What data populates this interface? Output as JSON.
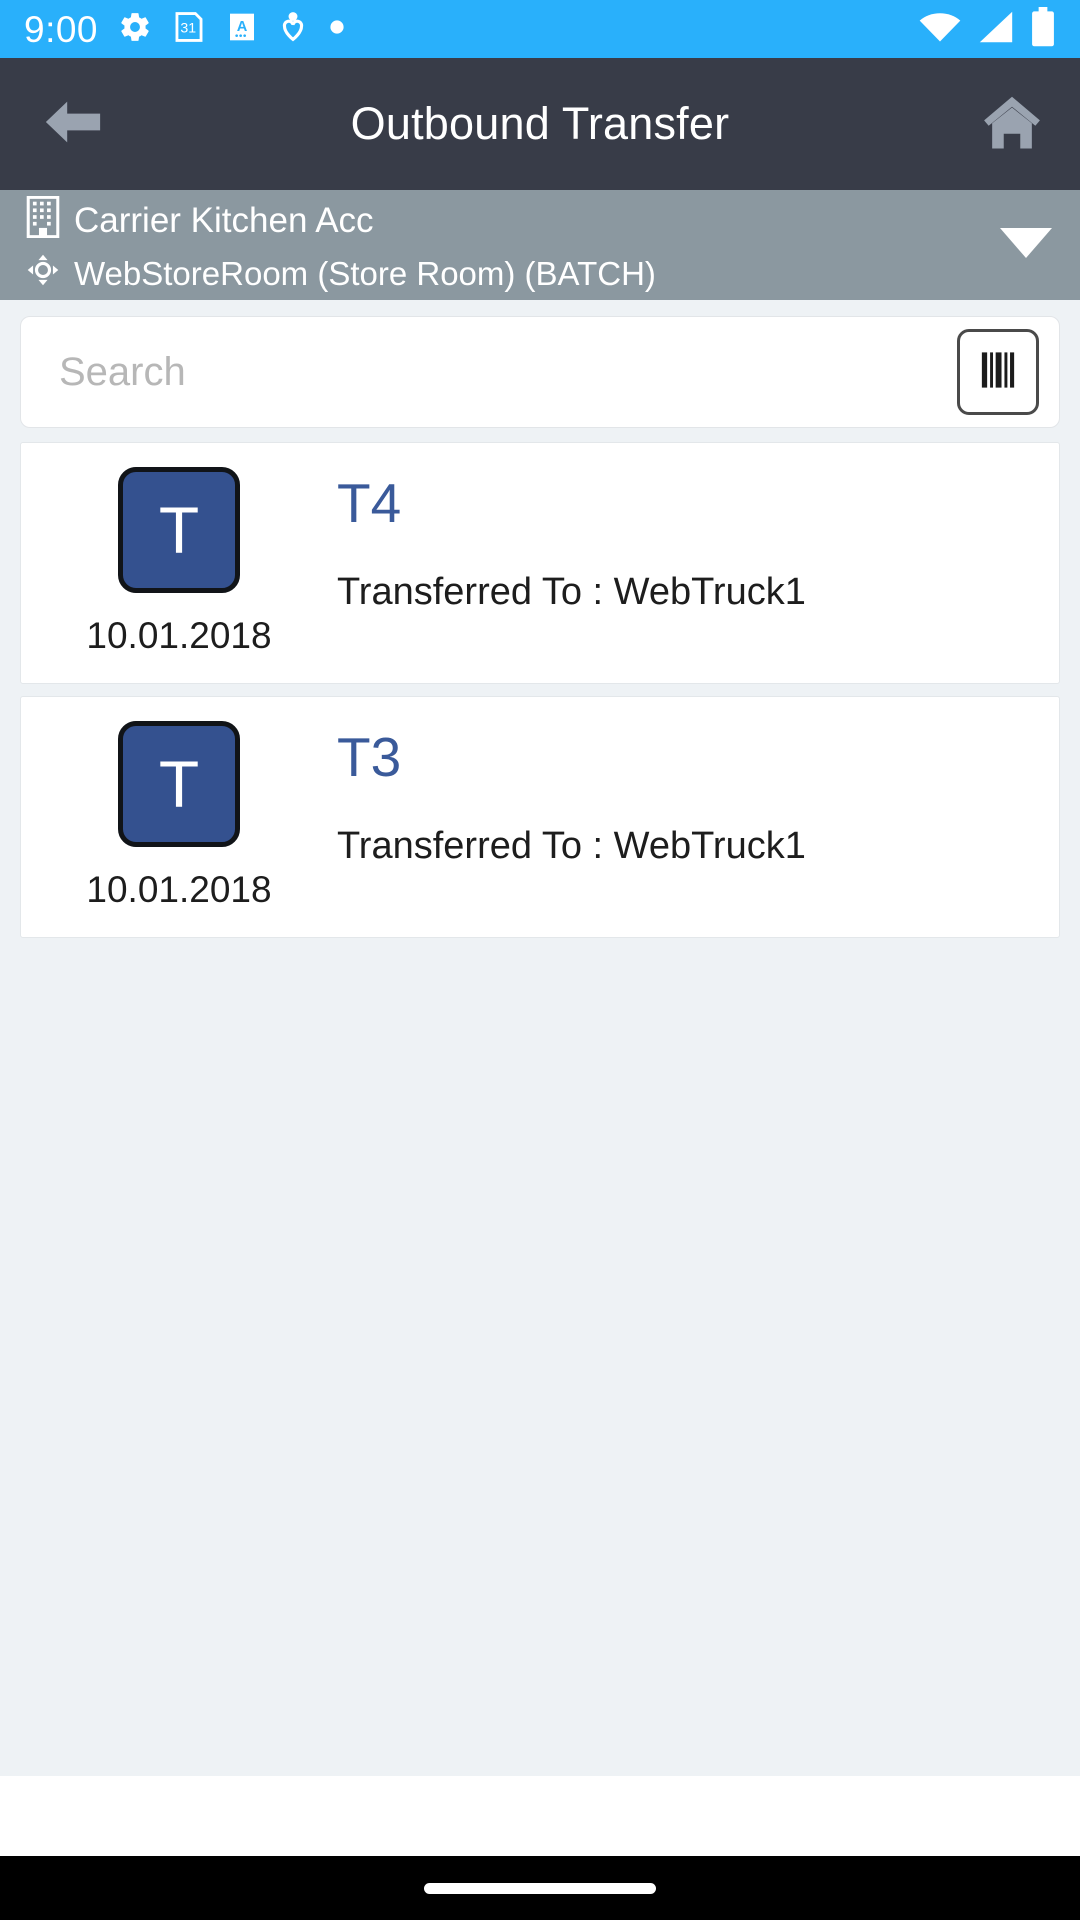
{
  "status_bar": {
    "clock": "9:00",
    "background_color": "#29b0fb",
    "left_icons": [
      "gear-icon",
      "calendar-31-icon",
      "a-app-icon",
      "pin-heart-icon",
      "dot-icon"
    ],
    "calendar_day": "31",
    "app_letter": "A",
    "right_icons": [
      "wifi-icon",
      "cell-signal-icon",
      "battery-icon"
    ]
  },
  "title_bar": {
    "title": "Outbound Transfer",
    "background_color": "#383c48",
    "back_icon": "back-arrow-icon",
    "home_icon": "home-icon"
  },
  "context_bar": {
    "background_color": "#8b98a0",
    "organization": "Carrier Kitchen Acc",
    "organization_icon": "building-icon",
    "location": "WebStoreRoom (Store Room)  (BATCH)",
    "location_icon": "move-crosshair-icon",
    "dropdown_icon": "caret-down-icon"
  },
  "search": {
    "value": "",
    "placeholder": "Search",
    "scan_button_icon": "barcode-icon"
  },
  "transfers": [
    {
      "avatar_letter": "T",
      "date": "10.01.2018",
      "title": "T4",
      "subtitle": "Transferred To : WebTruck1"
    },
    {
      "avatar_letter": "T",
      "date": "10.01.2018",
      "title": "T3",
      "subtitle": "Transferred To : WebTruck1"
    }
  ],
  "nav_bar": {
    "background_color": "#000000",
    "gesture_pill": "home-gesture-pill"
  },
  "colors": {
    "accent_blue": "#29b0fb",
    "header_dark": "#383c48",
    "context_gray": "#8b98a0",
    "avatar_navy": "#34518f",
    "title_blue": "#3a5a9a",
    "page_bg": "#eef2f5"
  }
}
